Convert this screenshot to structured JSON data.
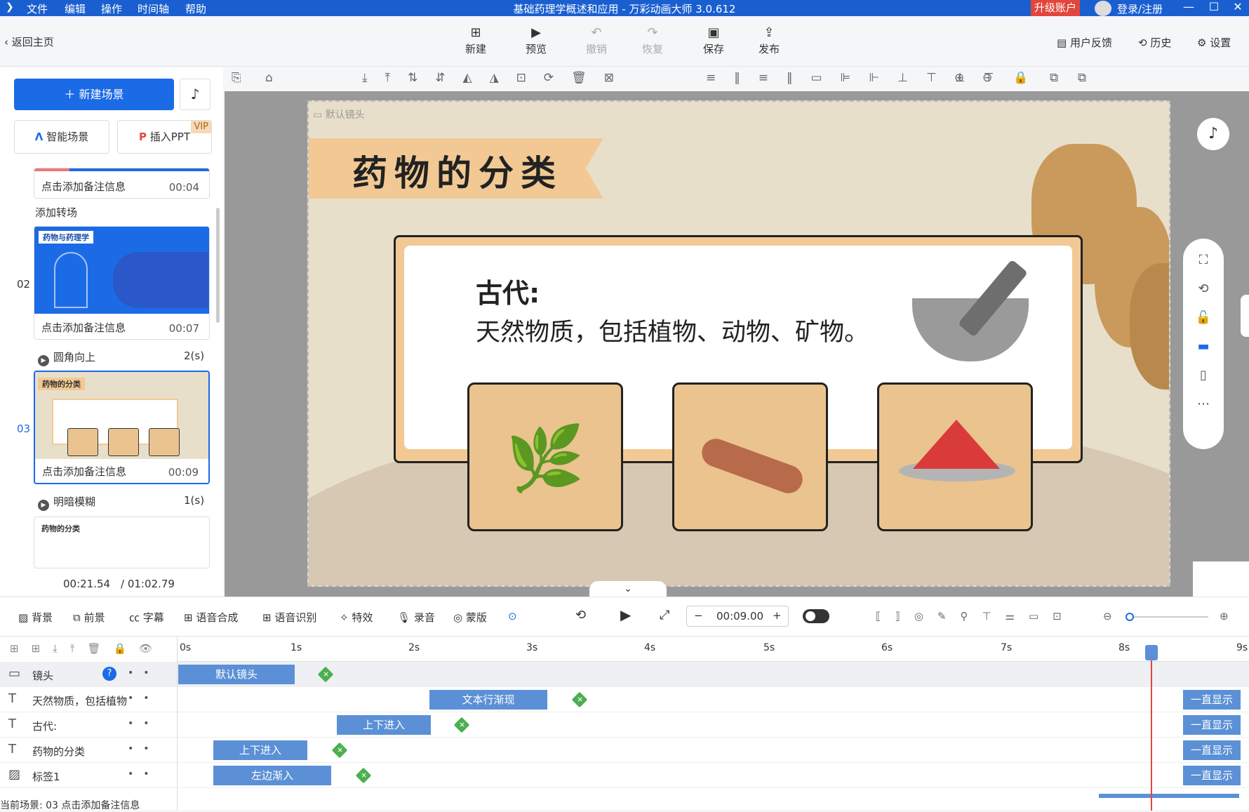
{
  "titlebar": {
    "menu": [
      "文件",
      "编辑",
      "操作",
      "时间轴",
      "帮助"
    ],
    "title": "基础药理学概述和应用 - 万彩动画大师 3.0.612",
    "upgrade": "升级账户",
    "login": "登录/注册"
  },
  "toolbar": {
    "back": "返回主页",
    "new": "新建",
    "preview": "预览",
    "undo": "撤销",
    "redo": "恢复",
    "save": "保存",
    "publish": "发布",
    "feedback": "用户反馈",
    "history": "历史",
    "settings": "设置"
  },
  "left": {
    "new_scene": "新建场景",
    "smart_scene": "智能场景",
    "insert_ppt": "插入PPT",
    "vip": "VIP",
    "add_transition": "添加转场",
    "scenes": [
      {
        "num": "",
        "note": "点击添加备注信息",
        "dur": "00:04"
      },
      {
        "num": "02",
        "note": "点击添加备注信息",
        "dur": "00:07",
        "thumb_title": "药物与药理学"
      },
      {
        "num": "03",
        "note": "点击添加备注信息",
        "dur": "00:09",
        "thumb_title": "药物的分类"
      },
      {
        "num": "",
        "thumb_title": "药物的分类"
      }
    ],
    "transitions": [
      {
        "name": "圆角向上",
        "dur": "2(s)"
      },
      {
        "name": "明暗模糊",
        "dur": "1(s)"
      }
    ],
    "time_current": "00:21.54",
    "time_total": "/ 01:02.79"
  },
  "canvas": {
    "camera_label": "默认镜头",
    "slide_title": "药物的分类",
    "heading": "古代:",
    "body": "天然物质，包括植物、动物、矿物。"
  },
  "bottom": {
    "items": [
      "背景",
      "前景",
      "字幕",
      "语音合成",
      "语音识别",
      "特效",
      "录音",
      "蒙版"
    ],
    "time": "00:09.00"
  },
  "timeline": {
    "ticks": [
      "0s",
      "1s",
      "2s",
      "3s",
      "4s",
      "5s",
      "6s",
      "7s",
      "8s",
      "9s"
    ],
    "tracks": [
      {
        "name": "镜头",
        "clip": "默认镜头"
      },
      {
        "name": "天然物质，包括植物",
        "clip": "文本行渐现",
        "always": "一直显示"
      },
      {
        "name": "古代:",
        "clip": "上下进入",
        "always": "一直显示"
      },
      {
        "name": "药物的分类",
        "clip": "上下进入",
        "always": "一直显示"
      },
      {
        "name": "标签1",
        "clip": "左边渐入",
        "always": "一直显示"
      }
    ],
    "status": "当前场景: 03   点击添加备注信息"
  }
}
